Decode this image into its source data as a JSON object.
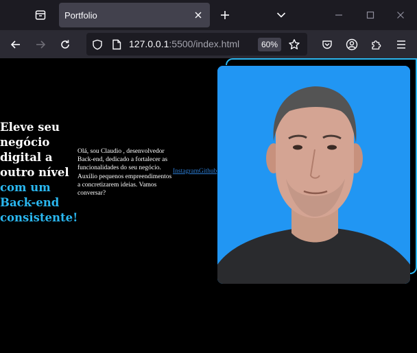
{
  "browser": {
    "tab_title": "Portfolio",
    "url_host": "127.0.0.1",
    "url_path": ":5500/index.html",
    "zoom": "60%"
  },
  "page": {
    "headline_line1": "Eleve seu negócio digital a outro nível",
    "headline_accent": "com um Back-end consistente!",
    "intro": "Olá, sou Claudio , desenvolvedor Back-end, dedicado a fortalecer as funcionalidades do seu negócio. Auxilio pequenos empreendimentos a concretizarem ideias. Vamos conversar?",
    "links": [
      {
        "label": "Instagram"
      },
      {
        "label": "Github"
      }
    ]
  },
  "colors": {
    "accent": "#2ab7f0",
    "photo_bg": "#2196f3",
    "link": "#2b7bd1"
  }
}
